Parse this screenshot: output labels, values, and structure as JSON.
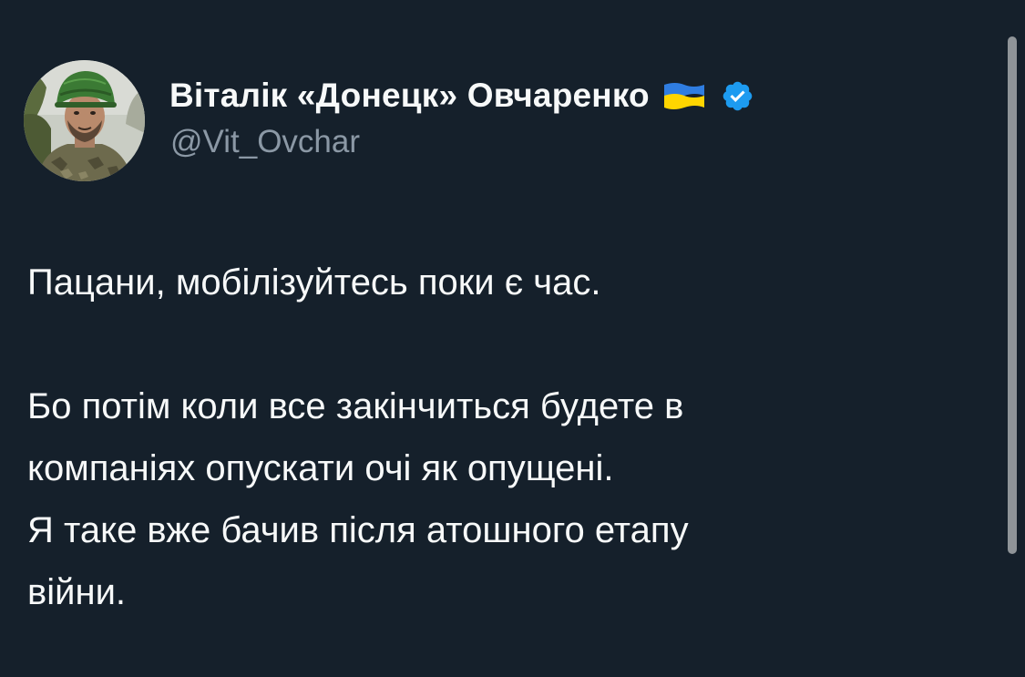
{
  "author": {
    "display_name": "Віталік «Донецк» Овчаренко",
    "handle": "@Vit_Ovchar",
    "flag_icon": "ukraine-flag-icon",
    "verified_icon": "verified-badge-icon",
    "verified_color": "#1d9bf0"
  },
  "tweet": {
    "paragraph_1": "Пацани, мобілізуйтесь поки є час.",
    "paragraph_2": "Бо потім коли все закінчиться будете в\nкомпаніях опускати очі як опущені.\nЯ таке вже бачив після атошного етапу\nвійни."
  },
  "theme": {
    "background": "#15202b",
    "text": "#f7f9f9",
    "secondary_text": "#8b98a5"
  }
}
